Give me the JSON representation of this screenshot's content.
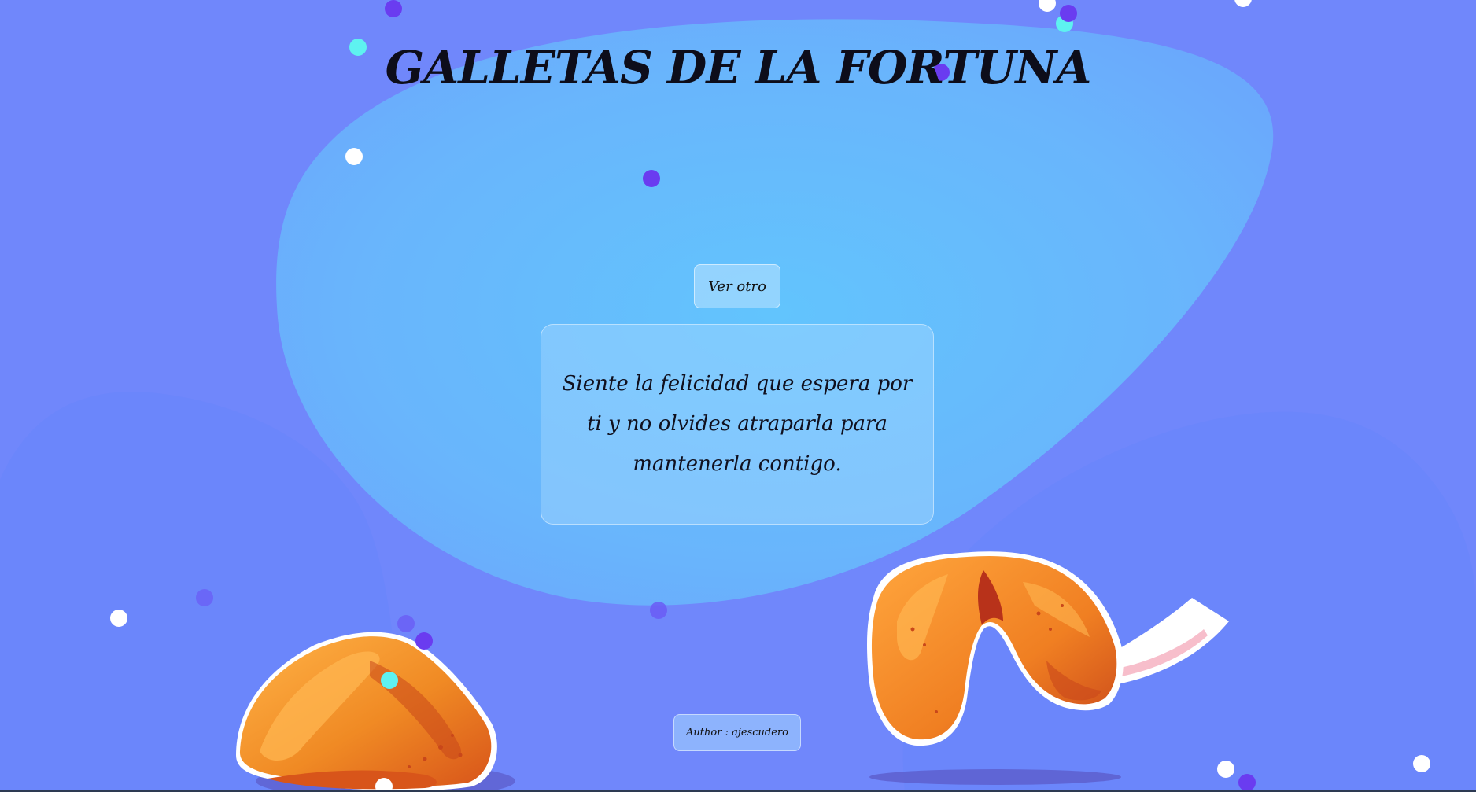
{
  "page": {
    "title": "GALLETAS DE LA FORTUNA"
  },
  "controls": {
    "next_button_label": "Ver otro"
  },
  "fortune": {
    "message": "Siente la felicidad que espera por ti y no olvides atraparla para mantenerla contigo."
  },
  "footer": {
    "author": "Author : ajescudero"
  },
  "theme": {
    "background": "#7087fb",
    "blob_light": "#66bffc",
    "cookie_orange": "#f08a24",
    "dot_purple": "#6a3cf0",
    "dot_cyan": "#5ef2f0",
    "dot_white": "#ffffff"
  },
  "icons": {
    "left_cookie": "fortune-cookie-icon",
    "right_cookie": "fortune-cookie-with-paper-icon"
  }
}
